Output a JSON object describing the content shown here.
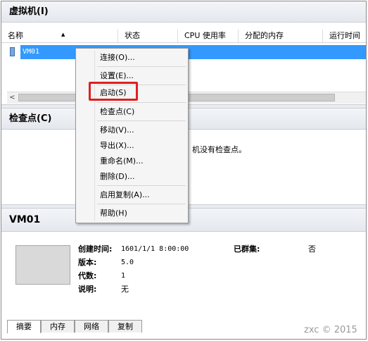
{
  "vm_panel": {
    "title": "虚拟机(I)",
    "columns": [
      "名称",
      "状态",
      "CPU 使用率",
      "分配的内存",
      "运行时间"
    ],
    "rows": [
      {
        "name": "VM01"
      }
    ]
  },
  "checkpoint_panel": {
    "title": "检查点(C)",
    "empty_note": "机没有检查点。"
  },
  "details_panel": {
    "title": "VM01",
    "fields": [
      {
        "label": "创建时间:",
        "value": "1601/1/1 8:00:00"
      },
      {
        "label": "版本:",
        "value": "5.0"
      },
      {
        "label": "代数:",
        "value": "1"
      },
      {
        "label": "说明:",
        "value": "无"
      }
    ],
    "clustered": {
      "label": "已群集:",
      "value": "否"
    },
    "tabs": [
      "摘要",
      "内存",
      "网络",
      "复制"
    ]
  },
  "context_menu": {
    "items": [
      "连接(O)...",
      "设置(E)...",
      "启动(S)",
      "检查点(C)",
      "移动(V)...",
      "导出(X)...",
      "重命名(M)...",
      "删除(D)...",
      "启用复制(A)...",
      "帮助(H)"
    ],
    "highlighted_item": "启动(S)",
    "highlight_color": "#e02020"
  },
  "watermark": "zxc © 2015",
  "colors": {
    "selection": "#3399ff"
  }
}
